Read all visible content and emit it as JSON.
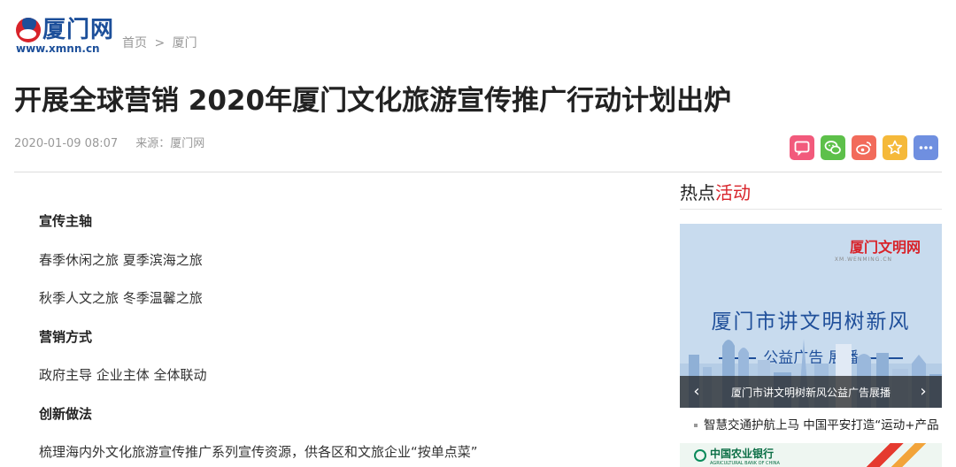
{
  "site": {
    "logo_cn": "厦门网",
    "logo_url": "www.xmnn.cn"
  },
  "breadcrumb": {
    "home": "首页",
    "separator": ">",
    "current": "厦门"
  },
  "article": {
    "title": "开展全球营销 2020年厦门文化旅游宣传推广行动计划出炉",
    "date": "2020-01-09 08:07",
    "source": "来源：厦门网",
    "paragraphs": [
      {
        "text": "宣传主轴",
        "heading": true
      },
      {
        "text": "春季休闲之旅 夏季滨海之旅",
        "heading": false
      },
      {
        "text": "秋季人文之旅 冬季温馨之旅",
        "heading": false
      },
      {
        "text": "营销方式",
        "heading": true
      },
      {
        "text": "政府主导 企业主体 全体联动",
        "heading": false
      },
      {
        "text": "创新做法",
        "heading": true
      },
      {
        "text": "梳理海内外文化旅游宣传推广系列宣传资源，供各区和文旅企业“按单点菜”",
        "heading": false
      }
    ]
  },
  "share": {
    "icons": [
      "comment-icon",
      "wechat-icon",
      "weibo-icon",
      "favorite-star-icon",
      "more-icon"
    ],
    "colors": [
      "#f25a7c",
      "#5dc04a",
      "#f26b5b",
      "#f5b93a",
      "#6f8fe0"
    ]
  },
  "sidebar": {
    "heading_plain": "热点",
    "heading_accent": "活动",
    "accent_color": "#d8232a",
    "banner": {
      "logo": "厦门文明网",
      "logo_sub": "XM.WENMING.CN",
      "slogan": "厦门市讲文明树新风",
      "sub": "公益广告 展播",
      "caption": "厦门市讲文明树新风公益广告展播",
      "prev_icon": "‹",
      "next_icon": "›"
    },
    "items": [
      {
        "text": "智慧交通护航上马 中国平安打造“运动+产品"
      }
    ],
    "bank": {
      "name": "中国农业银行",
      "name_en": "AGRICULTURAL BANK OF CHINA"
    }
  }
}
